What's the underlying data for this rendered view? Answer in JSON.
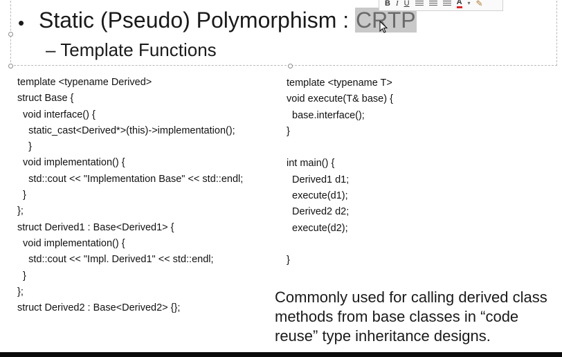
{
  "title": {
    "bullet": "•",
    "text_main": "Static (Pseudo) Polymorphism : ",
    "text_highlight": "CRTP"
  },
  "subtitle": {
    "dash": "–",
    "text": "Template Functions"
  },
  "mini_toolbar": {
    "bold": "B",
    "italic": "I",
    "underline": "U",
    "font_color": "A",
    "dropdown": "▾",
    "icons": [
      "align-left-icon",
      "align-center-icon",
      "align-right-icon",
      "paint-brush-icon"
    ]
  },
  "code_left": [
    "template <typename Derived>",
    "struct Base {",
    "  void interface() {",
    "    static_cast<Derived*>(this)->implementation();",
    "    }",
    "  void implementation() {",
    "    std::cout << \"Implementation Base\" << std::endl;",
    "  }",
    "};",
    "struct Derived1 : Base<Derived1> {",
    "  void implementation() {",
    "    std::cout << \"Impl. Derived1\" << std::endl;",
    "  }",
    "};",
    "struct Derived2 : Base<Derived2> {};"
  ],
  "code_right": [
    "template <typename T>",
    "void execute(T& base) {",
    "  base.interface();",
    "}",
    "",
    "int main() {",
    "  Derived1 d1;",
    "  execute(d1);",
    "  Derived2 d2;",
    "  execute(d2);",
    "",
    "}"
  ],
  "note": "Commonly used for calling derived class methods from base classes in “code reuse” type inheritance designs.",
  "colors": {
    "highlight_bg": "#c9c9c9",
    "text": "#1a1a1a",
    "font_color_swatch": "#e02020"
  }
}
